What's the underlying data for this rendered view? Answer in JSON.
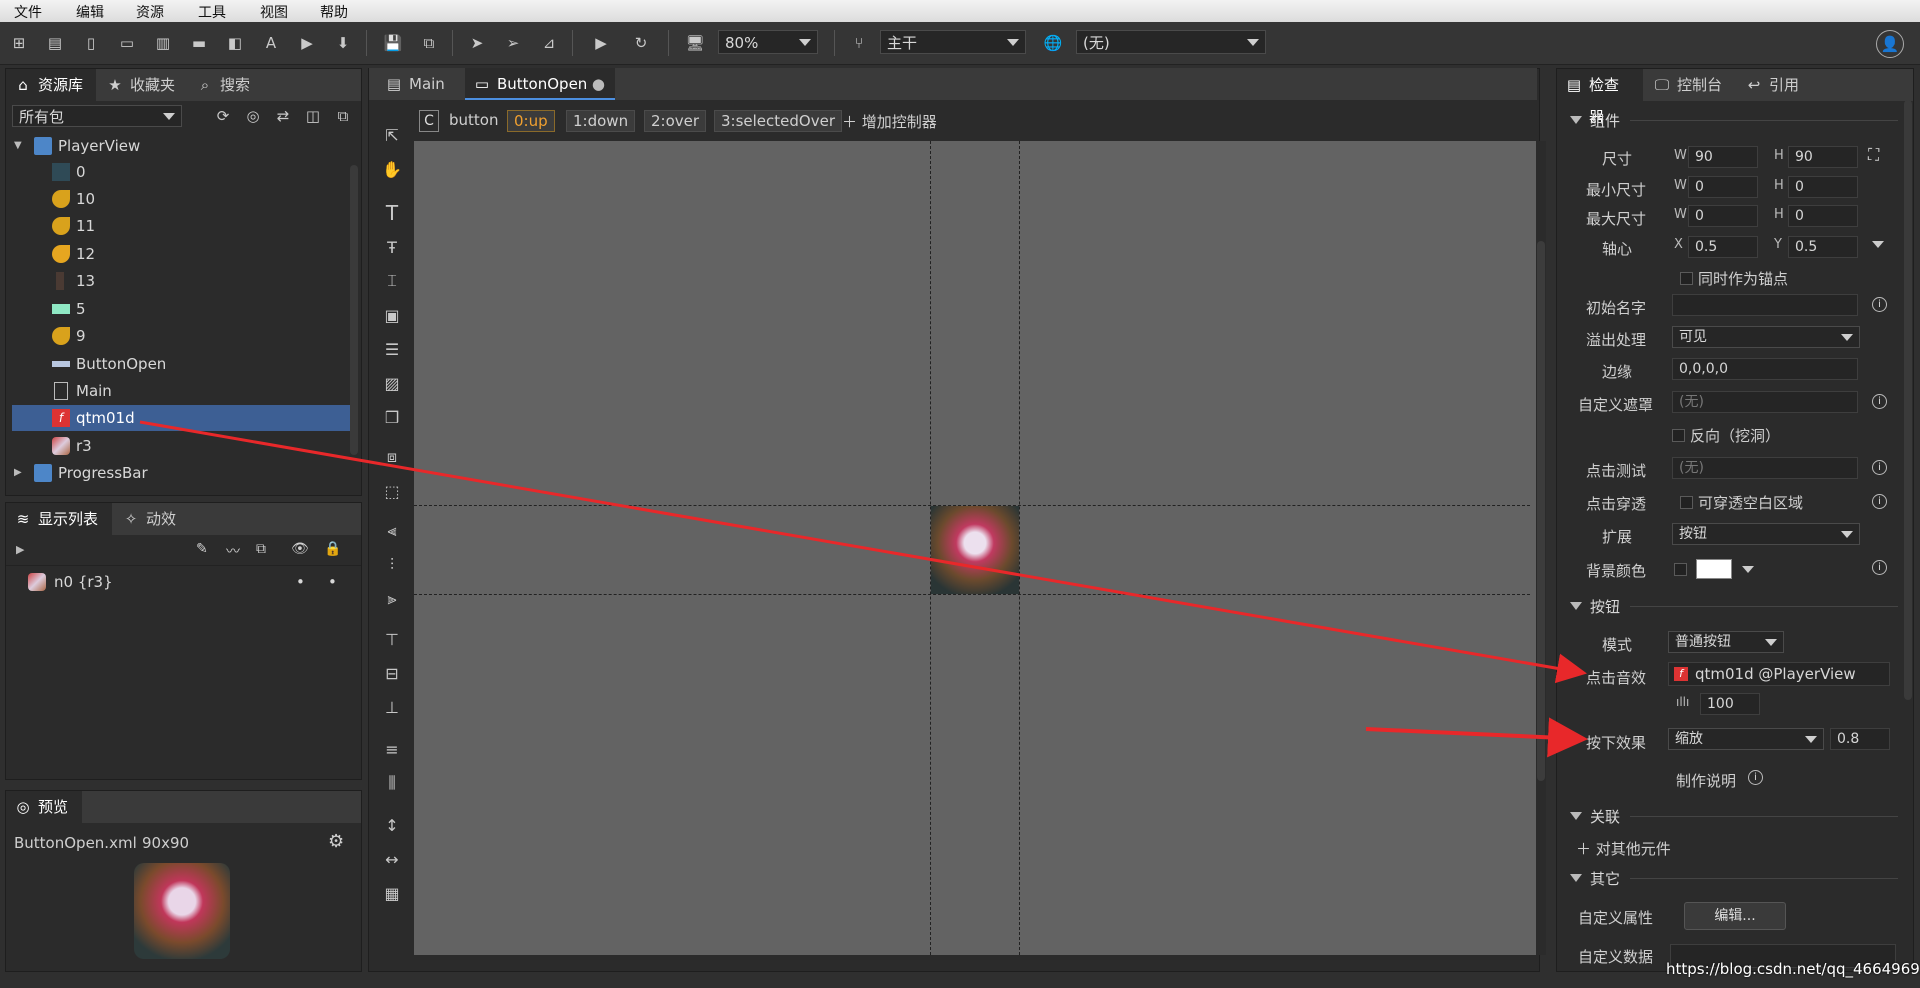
{
  "menu": [
    "文件",
    "编辑",
    "资源",
    "工具",
    "视图",
    "帮助"
  ],
  "toolbar": {
    "zoom": "80%",
    "branch": "主干",
    "language": "(无)"
  },
  "library": {
    "tabs": [
      "资源库",
      "收藏夹",
      "搜索"
    ],
    "filter": "所有包",
    "tree": [
      {
        "label": "PlayerView",
        "kind": "package",
        "expanded": true
      },
      {
        "label": "0",
        "kind": "image"
      },
      {
        "label": "10",
        "kind": "image"
      },
      {
        "label": "11",
        "kind": "image"
      },
      {
        "label": "12",
        "kind": "image"
      },
      {
        "label": "13",
        "kind": "image"
      },
      {
        "label": "5",
        "kind": "image"
      },
      {
        "label": "9",
        "kind": "image"
      },
      {
        "label": "ButtonOpen",
        "kind": "component"
      },
      {
        "label": "Main",
        "kind": "component"
      },
      {
        "label": "qtm01d",
        "kind": "sound",
        "selected": true
      },
      {
        "label": "r3",
        "kind": "image"
      },
      {
        "label": "ProgressBar",
        "kind": "package",
        "expanded": false
      }
    ]
  },
  "display_list": {
    "tabs": [
      "显示列表",
      "动效"
    ],
    "items": [
      {
        "label": "n0 {r3}"
      }
    ]
  },
  "preview": {
    "tab": "预览",
    "file": "ButtonOpen.xml",
    "size": "90x90"
  },
  "editor": {
    "tabs": [
      {
        "label": "Main",
        "active": false
      },
      {
        "label": "ButtonOpen",
        "active": true
      }
    ],
    "controller_letter": "C",
    "controller_name": "button",
    "pages": [
      "0:up",
      "1:down",
      "2:over",
      "3:selectedOver"
    ],
    "add_controller": "增加控制器"
  },
  "inspector": {
    "tabs": [
      "检查器",
      "控制台",
      "引用"
    ],
    "sections": {
      "component": "组件",
      "button": "按钮",
      "relation": "关联",
      "other": "其它"
    },
    "size_label": "尺寸",
    "w": "90",
    "h": "90",
    "min_label": "最小尺寸",
    "min_w": "0",
    "min_h": "0",
    "max_label": "最大尺寸",
    "max_w": "0",
    "max_h": "0",
    "pivot_label": "轴心",
    "pivot_x": "0.5",
    "pivot_y": "0.5",
    "anchor_label": "同时作为锚点",
    "init_name_label": "初始名字",
    "init_name": "",
    "overflow_label": "溢出处理",
    "overflow": "可见",
    "margin_label": "边缘",
    "margin": "0,0,0,0",
    "mask_label": "自定义遮罩",
    "mask": "(无)",
    "reverse_label": "反向（挖洞）",
    "hit_label": "点击测试",
    "hit": "(无)",
    "through_label": "点击穿透",
    "through_text": "可穿透空白区域",
    "extend_label": "扩展",
    "extend": "按钮",
    "bg_label": "背景颜色",
    "bg_color": "#ffffff",
    "mode_label": "模式",
    "mode": "普通按钮",
    "sound_label": "点击音效",
    "sound": "qtm01d @PlayerView",
    "volume": "100",
    "down_label": "按下效果",
    "down_effect": "缩放",
    "down_value": "0.8",
    "make_note": "制作说明",
    "relation_add": "对其他元件",
    "custom_prop_label": "自定义属性",
    "edit_button": "编辑...",
    "custom_data_label": "自定义数据",
    "wh_w": "W",
    "wh_h": "H",
    "xy_x": "X",
    "xy_y": "Y"
  },
  "watermark": "https://blog.csdn.net/qq_46649692"
}
